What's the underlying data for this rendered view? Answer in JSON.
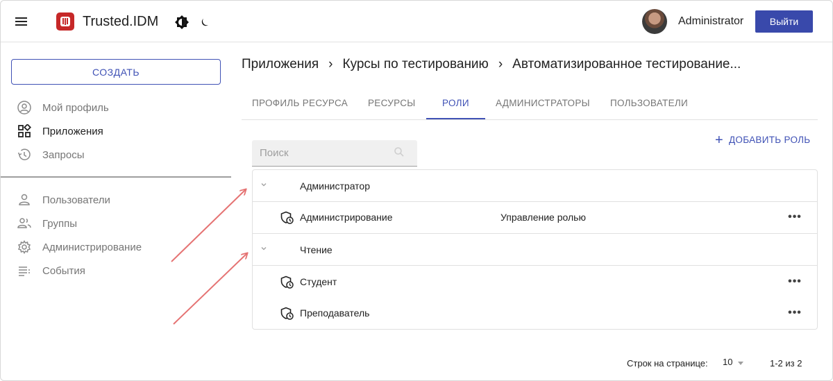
{
  "header": {
    "app_title": "Trusted.IDM",
    "user_name": "Administrator",
    "logout_label": "Выйти"
  },
  "sidebar": {
    "create_label": "СОЗДАТЬ",
    "items_top": [
      {
        "label": "Мой профиль",
        "icon": "account-circle-icon"
      },
      {
        "label": "Приложения",
        "icon": "apps-grid-icon",
        "active": true
      },
      {
        "label": "Запросы",
        "icon": "history-icon"
      }
    ],
    "items_admin": [
      {
        "label": "Пользователи",
        "icon": "person-icon"
      },
      {
        "label": "Группы",
        "icon": "group-icon"
      },
      {
        "label": "Администрирование",
        "icon": "gear-icon"
      },
      {
        "label": "События",
        "icon": "list-icon"
      }
    ]
  },
  "breadcrumb": [
    "Приложения",
    "Курсы по тестированию",
    "Автоматизированное тестирование..."
  ],
  "tabs": [
    {
      "label": "ПРОФИЛЬ РЕСУРСА"
    },
    {
      "label": "РЕСУРСЫ"
    },
    {
      "label": "РОЛИ",
      "active": true
    },
    {
      "label": "АДМИНИСТРАТОРЫ"
    },
    {
      "label": "ПОЛЬЗОВАТЕЛИ"
    }
  ],
  "toolbar": {
    "add_role_label": "ДОБАВИТЬ РОЛЬ",
    "search_placeholder": "Поиск",
    "search_value": ""
  },
  "role_groups": [
    {
      "name": "Администратор",
      "roles": [
        {
          "name": "Администрирование",
          "description": "Управление ролью"
        }
      ]
    },
    {
      "name": "Чтение",
      "roles": [
        {
          "name": "Студент",
          "description": ""
        },
        {
          "name": "Преподаватель",
          "description": ""
        }
      ]
    }
  ],
  "pagination": {
    "rows_per_page_label": "Строк на странице:",
    "rows_per_page": "10",
    "range": "1-2 из 2"
  },
  "colors": {
    "accent": "#3f51b5",
    "logout_bg": "#3949ab",
    "logo_red": "#c62828",
    "annotation_arrow": "#e57373"
  }
}
